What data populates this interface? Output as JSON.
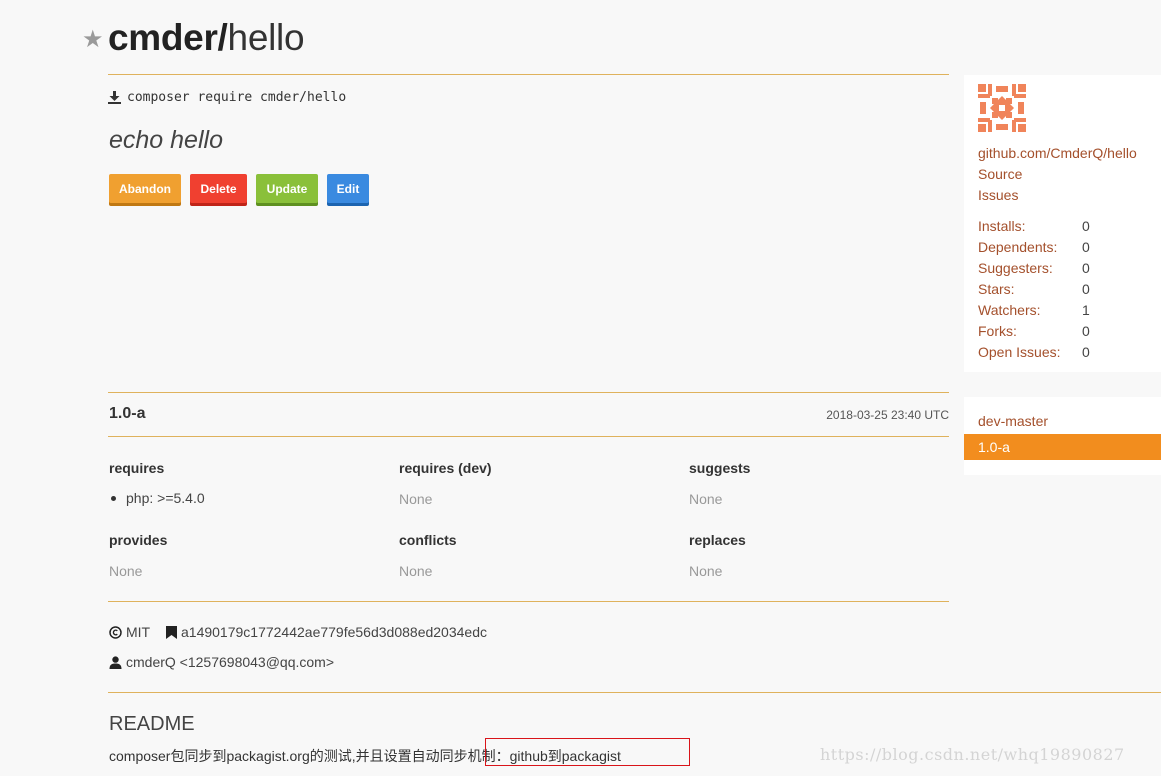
{
  "header": {
    "vendor": "cmder/",
    "package": "hello"
  },
  "install": {
    "command": "composer require cmder/hello"
  },
  "description": "echo hello",
  "actions": {
    "abandon": "Abandon",
    "delete": "Delete",
    "update": "Update",
    "edit": "Edit"
  },
  "sidebar": {
    "links": [
      "github.com/CmderQ/hello",
      "Source",
      "Issues"
    ],
    "stats": [
      {
        "label": "Installs:",
        "value": "0"
      },
      {
        "label": "Dependents:",
        "value": "0"
      },
      {
        "label": "Suggesters:",
        "value": "0"
      },
      {
        "label": "Stars:",
        "value": "0"
      },
      {
        "label": "Watchers:",
        "value": "1"
      },
      {
        "label": "Forks:",
        "value": "0"
      },
      {
        "label": "Open Issues:",
        "value": "0"
      }
    ],
    "versions": [
      "dev-master",
      "1.0-a"
    ]
  },
  "version": {
    "name": "1.0-a",
    "date": "2018-03-25 23:40 UTC",
    "requires": {
      "label": "requires",
      "items": [
        "php: >=5.4.0"
      ]
    },
    "requires_dev": {
      "label": "requires (dev)",
      "value": "None"
    },
    "suggests": {
      "label": "suggests",
      "value": "None"
    },
    "provides": {
      "label": "provides",
      "value": "None"
    },
    "conflicts": {
      "label": "conflicts",
      "value": "None"
    },
    "replaces": {
      "label": "replaces",
      "value": "None"
    },
    "license": "MIT",
    "reference": "a1490179c1772442ae779fe56d3d088ed2034edc",
    "author": "cmderQ <1257698043@qq.com>"
  },
  "readme": {
    "heading": "README",
    "text": "composer包同步到packagist.org的测试,并且设置自动同步机制：github到packagist"
  },
  "watermark": "https://blog.csdn.net/whq19890827",
  "colors": {
    "accent_line": "#dfb25c",
    "link": "#a4502c",
    "active_version": "#f28d1e",
    "abandon": "#f0a030",
    "delete": "#f04030",
    "update": "#8ac03a",
    "edit": "#3a8ae0"
  }
}
